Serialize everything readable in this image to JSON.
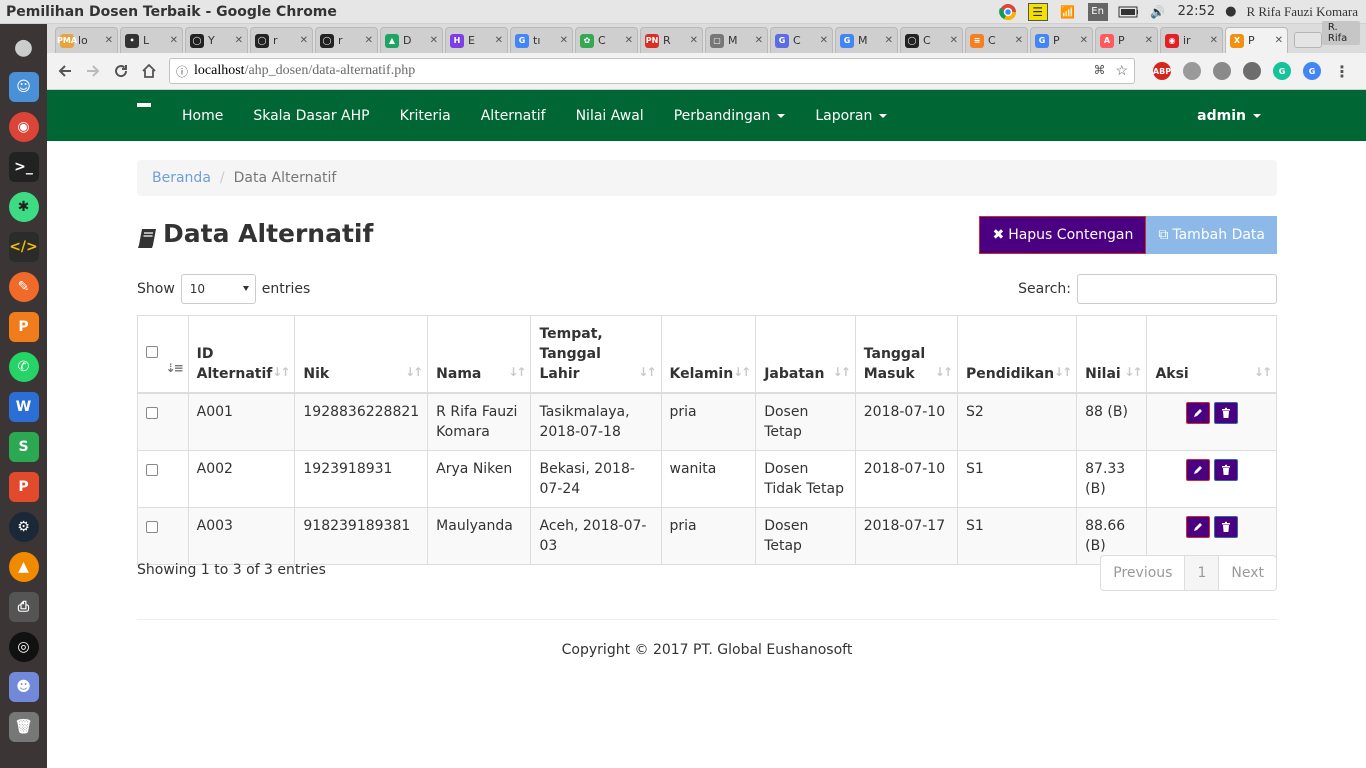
{
  "os": {
    "window_title": "Pemilihan Dosen Terbaik - Google Chrome",
    "clock": "22:52",
    "user": "R Rifa Fauzi Komara",
    "lang": "En"
  },
  "dock": [
    "apple",
    "finder",
    "chrome",
    "terminal",
    "android",
    "code-editor",
    "inkscape",
    "pdf",
    "whatsapp",
    "wps-writer",
    "wps-spreadsheet",
    "wps-presentation",
    "steam",
    "vlc",
    "printer",
    "obs",
    "discord",
    "trash"
  ],
  "browser": {
    "tabs": [
      {
        "fav": "PMA",
        "title": "lo",
        "color": "#e8a33d"
      },
      {
        "fav": "•",
        "title": "L",
        "color": "#333333"
      },
      {
        "fav": "◯",
        "title": "Y",
        "color": "#222222"
      },
      {
        "fav": "◯",
        "title": "r",
        "color": "#222222"
      },
      {
        "fav": "◯",
        "title": "r",
        "color": "#222222"
      },
      {
        "fav": "▲",
        "title": "D",
        "color": "#1fa463"
      },
      {
        "fav": "H",
        "title": "E",
        "color": "#7b3fe4"
      },
      {
        "fav": "G",
        "title": "tı",
        "color": "#4285f4"
      },
      {
        "fav": "✿",
        "title": "C",
        "color": "#34a853"
      },
      {
        "fav": "PN",
        "title": "R",
        "color": "#d93025"
      },
      {
        "fav": "▢",
        "title": "M",
        "color": "#777777"
      },
      {
        "fav": "G",
        "title": "C",
        "color": "#5b6ee1"
      },
      {
        "fav": "G",
        "title": "M",
        "color": "#4285f4"
      },
      {
        "fav": "◯",
        "title": "C",
        "color": "#222222"
      },
      {
        "fav": "≡",
        "title": "C",
        "color": "#f48024"
      },
      {
        "fav": "G",
        "title": "P",
        "color": "#4285f4"
      },
      {
        "fav": "A",
        "title": "P",
        "color": "#ff5a5f"
      },
      {
        "fav": "◉",
        "title": "ir",
        "color": "#e22127"
      },
      {
        "fav": "X",
        "title": "P",
        "color": "#f29111"
      }
    ],
    "profile": "R. Rifa",
    "url_host": "localhost",
    "url_path": "/ahp_dosen/data-alternatif.php"
  },
  "nav": {
    "items": [
      "Home",
      "Skala Dasar AHP",
      "Kriteria",
      "Alternatif",
      "Nilai Awal"
    ],
    "dropdowns": [
      "Perbandingan",
      "Laporan"
    ],
    "user": "admin"
  },
  "breadcrumb": {
    "home": "Beranda",
    "current": "Data Alternatif"
  },
  "page_title": "Data Alternatif",
  "buttons": {
    "delete_selected": "Hapus Contengan",
    "add": "Tambah Data"
  },
  "length": {
    "prefix": "Show",
    "value": "10",
    "suffix": "entries"
  },
  "search_label": "Search:",
  "table": {
    "headers": [
      "ID Alternatif",
      "Nik",
      "Nama",
      "Tempat, Tanggal Lahir",
      "Kelamin",
      "Jabatan",
      "Tanggal Masuk",
      "Pendidikan",
      "Nilai",
      "Aksi"
    ],
    "rows": [
      [
        "A001",
        "1928836228821",
        "R Rifa Fauzi Komara",
        "Tasikmalaya, 2018-07-18",
        "pria",
        "Dosen Tetap",
        "2018-07-10",
        "S2",
        "88 (B)"
      ],
      [
        "A002",
        "1923918931",
        "Arya Niken",
        "Bekasi, 2018-07-24",
        "wanita",
        "Dosen Tidak Tetap",
        "2018-07-10",
        "S1",
        "87.33 (B)"
      ],
      [
        "A003",
        "918239189381",
        "Maulyanda",
        "Aceh, 2018-07-03",
        "pria",
        "Dosen Tetap",
        "2018-07-17",
        "S1",
        "88.66 (B)"
      ]
    ]
  },
  "info": "Showing 1 to 3 of 3 entries",
  "pagination": {
    "previous": "Previous",
    "page": "1",
    "next": "Next"
  },
  "footer": "Copyright © 2017 PT. Global Eushanosoft",
  "colors": {
    "navbar": "#006633",
    "danger_btn": "#4b0082",
    "primary_btn": "#8db9e8"
  }
}
